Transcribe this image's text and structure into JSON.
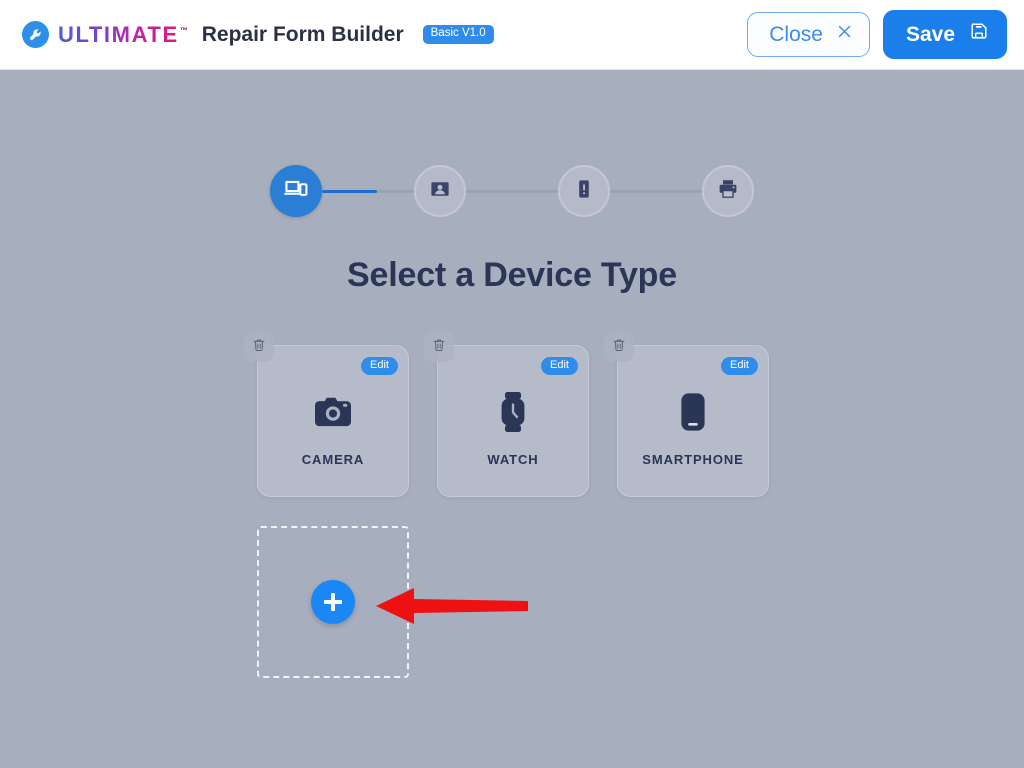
{
  "header": {
    "logo_icon": "wrench-circle-logo-icon",
    "brand": "ULTIMATE",
    "brand_tm": "™",
    "app_title": "Repair Form Builder",
    "version_badge": "Basic V1.0",
    "close_label": "Close",
    "close_icon": "close-x-icon",
    "save_label": "Save",
    "save_icon": "floppy-disk-save-icon",
    "accent_blue": "#1a7eeb",
    "close_border": "#6ca9ee"
  },
  "stepper": {
    "progress_percent": 60,
    "steps": [
      {
        "icon": "devices-icon",
        "state": "active"
      },
      {
        "icon": "contact-card-icon",
        "state": "idle"
      },
      {
        "icon": "phone-issue-icon",
        "state": "idle"
      },
      {
        "icon": "printer-icon",
        "state": "idle"
      }
    ]
  },
  "main": {
    "title": "Select a Device Type",
    "edit_label": "Edit",
    "delete_icon": "trash-icon",
    "cards": [
      {
        "label": "CAMERA",
        "icon": "camera-icon"
      },
      {
        "label": "WATCH",
        "icon": "watch-icon"
      },
      {
        "label": "SMARTPHONE",
        "icon": "smartphone-icon"
      }
    ],
    "add_card": {
      "icon": "plus-icon"
    }
  },
  "annotation": {
    "arrow_icon": "red-arrow-left-icon",
    "arrow_color": "#ee1111"
  },
  "theme": {
    "page_background": "#a7aebd",
    "card_label_color": "#2b3556",
    "title_color": "#2b3556"
  }
}
